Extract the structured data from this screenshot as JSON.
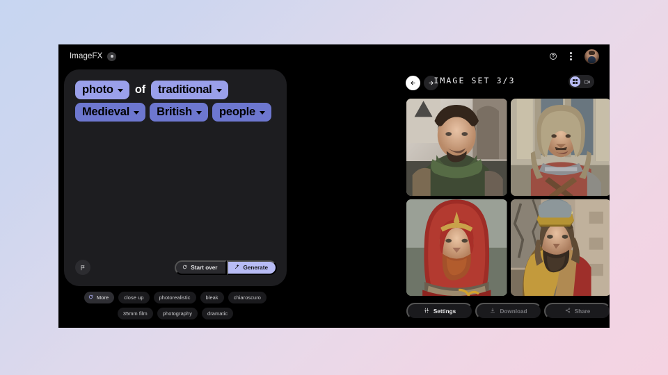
{
  "background": {
    "from": "#c7d6f1",
    "to": "#f4d3e2"
  },
  "app": {
    "brand": "ImageFX",
    "brand_badge_icon": "sparkle-dot-icon",
    "help_icon": "help-circle-icon",
    "overflow_icon": "more-vertical-icon",
    "avatar_icon": "user-avatar"
  },
  "prompt": {
    "tokens": [
      {
        "type": "chip",
        "label": "photo",
        "shade": "light"
      },
      {
        "type": "text",
        "label": "of"
      },
      {
        "type": "chip",
        "label": "traditional",
        "shade": "light"
      },
      {
        "type": "chip",
        "label": "Medieval",
        "shade": "mid"
      },
      {
        "type": "chip",
        "label": "British",
        "shade": "mid"
      },
      {
        "type": "chip",
        "label": "people",
        "shade": "mid"
      }
    ],
    "chip_colors": {
      "light": "#9aa0ea",
      "mid": "#6d77cf"
    },
    "flag_icon": "flag-icon",
    "start_over_label": "Start over",
    "start_over_icon": "refresh-icon",
    "generate_label": "Generate",
    "generate_icon": "magic-wand-icon",
    "generate_color": "#b8bcf5"
  },
  "suggestions": {
    "more_label": "More",
    "more_icon": "refresh-icon",
    "chips": [
      "close up",
      "photorealistic",
      "bleak",
      "chiaroscuro",
      "35mm film",
      "photography",
      "dramatic"
    ]
  },
  "results": {
    "title": "IMAGE SET 3/3",
    "prev_icon": "arrow-left-icon",
    "next_icon": "arrow-right-icon",
    "view_toggle": {
      "grid_icon": "grid-view-icon",
      "single_icon": "single-view-icon",
      "selected": "grid"
    },
    "images": [
      {
        "name": "medieval-man-green-scarf",
        "alt": "Bearded man with dark hair, green scarf and leather armor before a stone castle"
      },
      {
        "name": "medieval-man-tan-hood",
        "alt": "Man in tan fur-lined hood and red tunic with chainmail, gothic windows behind"
      },
      {
        "name": "medieval-man-red-hood",
        "alt": "Red-bearded man in crimson hood with gold circlet and embroidered robe"
      },
      {
        "name": "medieval-king-crown",
        "alt": "Bearded king wearing a golden crown and mustard cloak over red garments"
      }
    ],
    "actions": [
      {
        "label": "Settings",
        "icon": "sliders-icon",
        "state": "enabled"
      },
      {
        "label": "Download",
        "icon": "download-icon",
        "state": "disabled"
      },
      {
        "label": "Share",
        "icon": "share-icon",
        "state": "disabled"
      }
    ]
  }
}
